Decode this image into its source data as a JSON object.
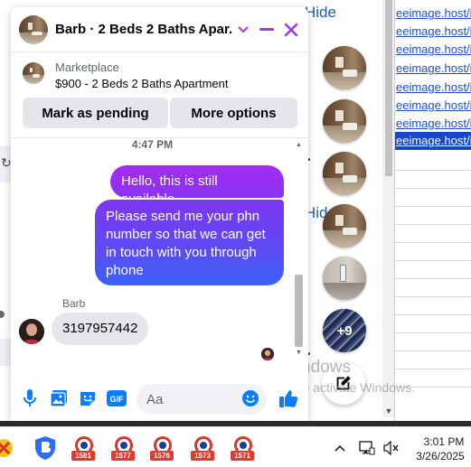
{
  "background": {
    "hide_link_1": "Hide",
    "hide_link_2": "Hide",
    "links": [
      "eeimage.host/i/",
      "eeimage.host/i/",
      "eeimage.host/i/",
      "eeimage.host/i/",
      "eeimage.host/i/",
      "eeimage.host/i/",
      "eeimage.host/i/",
      "eeimage.host/i/"
    ]
  },
  "chat_heads": {
    "more_count": "+9"
  },
  "chat": {
    "title": "Barb · 2 Beds 2 Baths Apar...",
    "listing": {
      "source": "Marketplace",
      "name": "$900 - 2 Beds 2 Baths Apartment",
      "mark_pending_label": "Mark as pending",
      "more_options_label": "More options"
    },
    "thread": {
      "timestamp": "4:47 PM",
      "messages": [
        {
          "from": "me",
          "text": "Hello, this is still available"
        },
        {
          "from": "me",
          "text": "Please send me your phn number so that we can get in touch with you through phone"
        },
        {
          "from": "Barb",
          "text": "3197957442"
        }
      ],
      "sender_name": "Barb"
    },
    "composer": {
      "placeholder": "Aa"
    }
  },
  "watermark": {
    "title": "Activate Windows",
    "subtitle": "Go to Settings to activate Windows."
  },
  "taskbar": {
    "apps": [
      {
        "badge": "1581"
      },
      {
        "badge": "1577"
      },
      {
        "badge": "1576"
      },
      {
        "badge": "1573"
      },
      {
        "badge": "1571"
      }
    ],
    "time": "3:01 PM",
    "date": "3/26/2025"
  },
  "colors": {
    "messenger_purple": "#9b2bf0",
    "messenger_blue": "#3c5ef5",
    "brand_accent": "#a033ff",
    "link_blue": "#1e4fc4"
  }
}
